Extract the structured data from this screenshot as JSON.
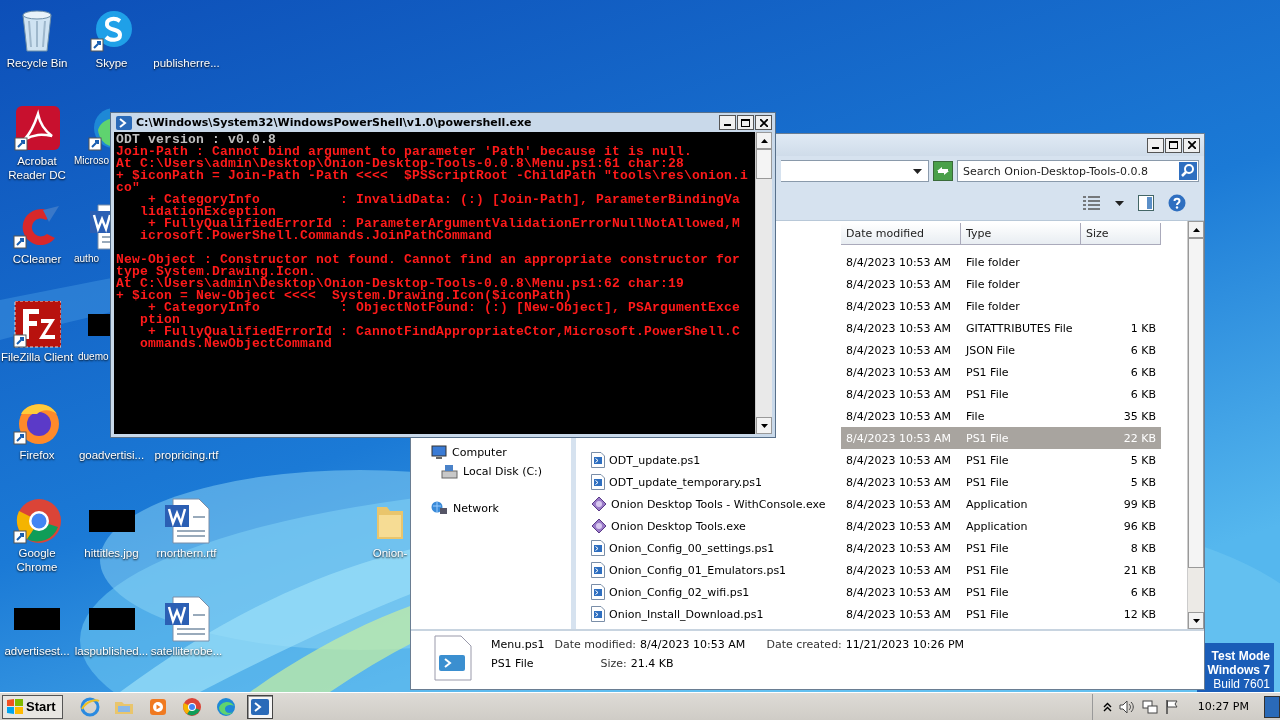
{
  "desktop": {
    "columns": [
      {
        "items": [
          {
            "label": "Recycle Bin",
            "kind": "recycle"
          },
          {
            "label": "Acrobat Reader DC",
            "kind": "acrobat"
          },
          {
            "label": "CCleaner",
            "kind": "ccleaner"
          },
          {
            "label": "FileZilla Client",
            "kind": "filezilla"
          },
          {
            "label": "Firefox",
            "kind": "firefox"
          },
          {
            "label": "Google Chrome",
            "kind": "chrome"
          },
          {
            "label": "advertisest...",
            "kind": "redacted"
          }
        ]
      },
      {
        "items": [
          {
            "label": "Skype",
            "kind": "skype"
          },
          {
            "label": "Microso",
            "kind": "edge"
          },
          {
            "label": "autho",
            "kind": "word"
          },
          {
            "label": "duemo",
            "kind": "redacted"
          },
          {
            "label": "goadvertisi..."
          },
          {
            "label": "hittitles.jpg",
            "kind": "redacted"
          },
          {
            "label": "laspublished...",
            "kind": "redacted"
          }
        ]
      },
      {
        "items": [
          {
            "label": "publisherre..."
          },
          {
            "label": "propricing.rtf"
          },
          {
            "label": "rnorthern.rtf",
            "kind": "word"
          },
          {
            "label": "satelliterobe...",
            "kind": "word"
          }
        ]
      },
      {
        "items": [
          {
            "label": "Onion-",
            "kind": "folder"
          }
        ]
      }
    ],
    "test_mode": [
      "Test Mode",
      "Windows 7",
      "Build 7601"
    ]
  },
  "console": {
    "title": "C:\\Windows\\System32\\WindowsPowerShell\\v1.0\\powershell.exe",
    "output": "ODT version : v0.0.8",
    "errors": [
      [
        "Join-Path : Cannot bind argument to parameter 'Path' because it is null.",
        "At C:\\Users\\admin\\Desktop\\Onion-Desktop-Tools-0.0.8\\Menu.ps1:61 char:28",
        "+ $iconPath = Join-Path -Path <<<<  $PSScriptRoot -ChildPath \"tools\\res\\onion.i",
        "co\"",
        "    + CategoryInfo          : InvalidData: (:) [Join-Path], ParameterBindingVa",
        "   lidationException",
        "    + FullyQualifiedErrorId : ParameterArgumentValidationErrorNullNotAllowed,M",
        "   icrosoft.PowerShell.Commands.JoinPathCommand"
      ],
      [
        "New-Object : Constructor not found. Cannot find an appropriate constructor for",
        "type System.Drawing.Icon.",
        "At C:\\Users\\admin\\Desktop\\Onion-Desktop-Tools-0.0.8\\Menu.ps1:62 char:19",
        "+ $icon = New-Object <<<<  System.Drawing.Icon($iconPath)",
        "    + CategoryInfo          : ObjectNotFound: (:) [New-Object], PSArgumentExce",
        "   ption",
        "    + FullyQualifiedErrorId : CannotFindAppropriateCtor,Microsoft.PowerShell.C",
        "   ommands.NewObjectCommand"
      ]
    ]
  },
  "explorer": {
    "search": {
      "placeholder": "Search Onion-Desktop-Tools-0.0.8"
    },
    "columns": [
      "Date modified",
      "Type",
      "Size"
    ],
    "nav": [
      {
        "label": "Computer",
        "kind": "computer",
        "children": [
          {
            "label": "Local Disk (C:)",
            "kind": "disk"
          }
        ]
      },
      {
        "label": "Network",
        "kind": "network"
      }
    ],
    "rows": [
      {
        "date": "8/4/2023 10:53 AM",
        "type": "File folder",
        "selected": false
      },
      {
        "date": "8/4/2023 10:53 AM",
        "type": "File folder",
        "selected": false
      },
      {
        "date": "8/4/2023 10:53 AM",
        "type": "File folder",
        "selected": false
      },
      {
        "date": "8/4/2023 10:53 AM",
        "type": "GITATTRIBUTES File",
        "size": "1 KB",
        "selected": false
      },
      {
        "date": "8/4/2023 10:53 AM",
        "type": "JSON File",
        "size": "6 KB",
        "selected": false
      },
      {
        "date": "8/4/2023 10:53 AM",
        "type": "PS1 File",
        "size": "6 KB",
        "selected": false
      },
      {
        "date": "8/4/2023 10:53 AM",
        "type": "PS1 File",
        "size": "6 KB",
        "selected": false
      },
      {
        "date": "8/4/2023 10:53 AM",
        "type": "File",
        "size": "35 KB",
        "selected": false
      },
      {
        "date": "8/4/2023 10:53 AM",
        "type": "PS1 File",
        "size": "22 KB",
        "selected": true
      },
      {
        "name": "ODT_update.ps1",
        "kind": "script",
        "date": "8/4/2023 10:53 AM",
        "type": "PS1 File",
        "size": "5 KB",
        "selected": false
      },
      {
        "name": "ODT_update_temporary.ps1",
        "kind": "script",
        "date": "8/4/2023 10:53 AM",
        "type": "PS1 File",
        "size": "5 KB",
        "selected": false
      },
      {
        "name": "Onion Desktop Tools - WithConsole.exe",
        "kind": "app",
        "date": "8/4/2023 10:53 AM",
        "type": "Application",
        "size": "99 KB",
        "selected": false
      },
      {
        "name": "Onion Desktop Tools.exe",
        "kind": "app",
        "date": "8/4/2023 10:53 AM",
        "type": "Application",
        "size": "96 KB",
        "selected": false
      },
      {
        "name": "Onion_Config_00_settings.ps1",
        "kind": "script",
        "date": "8/4/2023 10:53 AM",
        "type": "PS1 File",
        "size": "8 KB",
        "selected": false
      },
      {
        "name": "Onion_Config_01_Emulators.ps1",
        "kind": "script",
        "date": "8/4/2023 10:53 AM",
        "type": "PS1 File",
        "size": "21 KB",
        "selected": false
      },
      {
        "name": "Onion_Config_02_wifi.ps1",
        "kind": "script",
        "date": "8/4/2023 10:53 AM",
        "type": "PS1 File",
        "size": "6 KB",
        "selected": false
      },
      {
        "name": "Onion_Install_Download.ps1",
        "kind": "script",
        "date": "8/4/2023 10:53 AM",
        "type": "PS1 File",
        "size": "12 KB",
        "selected": false
      }
    ],
    "details": {
      "name": "Menu.ps1",
      "type": "PS1 File",
      "fields": [
        {
          "label": "Date modified:",
          "value": "8/4/2023 10:53 AM"
        },
        {
          "label": "Size:",
          "value": "21.4 KB"
        },
        {
          "label": "Date created:",
          "value": "11/21/2023 10:26 PM"
        }
      ]
    }
  },
  "taskbar": {
    "start": "Start",
    "apps": [
      {
        "kind": "ie",
        "selected": false
      },
      {
        "kind": "explorer",
        "selected": false
      },
      {
        "kind": "media",
        "selected": false
      },
      {
        "kind": "chrome",
        "selected": false
      },
      {
        "kind": "edge",
        "selected": false
      },
      {
        "kind": "powershell",
        "selected": true
      }
    ],
    "clock": "10:27 PM"
  }
}
